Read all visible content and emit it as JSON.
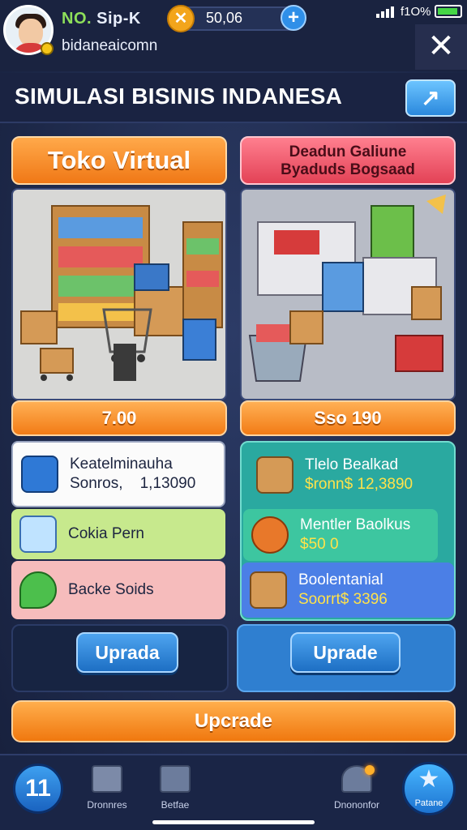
{
  "header": {
    "player_name_a": "NO.",
    "player_name_b": " Sip-K",
    "player_sub": "bidaneaicomn",
    "coin_symbol": "✕",
    "coin_value": "50,06",
    "plus": "+",
    "status_text": "f1O%",
    "close": "✕"
  },
  "title": {
    "text": "SIMULASI BISINIS INDANESA",
    "share_icon": "↗"
  },
  "left": {
    "header": "Toko Virtual",
    "price": "7.00",
    "cards": [
      {
        "line1": "Keatelminauha",
        "line2": "Sonros,    1,13090",
        "icon": "box-icon"
      },
      {
        "line1": "Cokia Pern",
        "icon": "document-icon"
      },
      {
        "line1": "Backe Soids",
        "icon": "leaf-shield-icon"
      }
    ],
    "upgrade": "Uprada"
  },
  "right": {
    "header_line1": "Deadun Galiune",
    "header_line2": "Byaduds Bogsaad",
    "price": "Sso 190",
    "cards": [
      {
        "line1": "Tlelo Bealkad",
        "line2": "$ronn$ 12,3890",
        "icon": "crate-icon"
      },
      {
        "line1": "Mentler Baolkus",
        "line2": "$50 0",
        "icon": "clock-icon"
      },
      {
        "line1": "Boolentanial",
        "line2": "Soorrt$ 3396",
        "icon": "package-icon"
      }
    ],
    "upgrade": "Uprade"
  },
  "main_upgrade": "Upcrade",
  "nav": {
    "home": "11",
    "items": [
      {
        "label": "Dronnres"
      },
      {
        "label": "Betfae"
      },
      {
        "label": "Dnononfor"
      }
    ],
    "star_label": "Patane",
    "star": "★"
  },
  "colors": {
    "accent_orange": "#f27b16",
    "accent_blue": "#2f8fe8",
    "bg_navy": "#1f2b4d"
  }
}
